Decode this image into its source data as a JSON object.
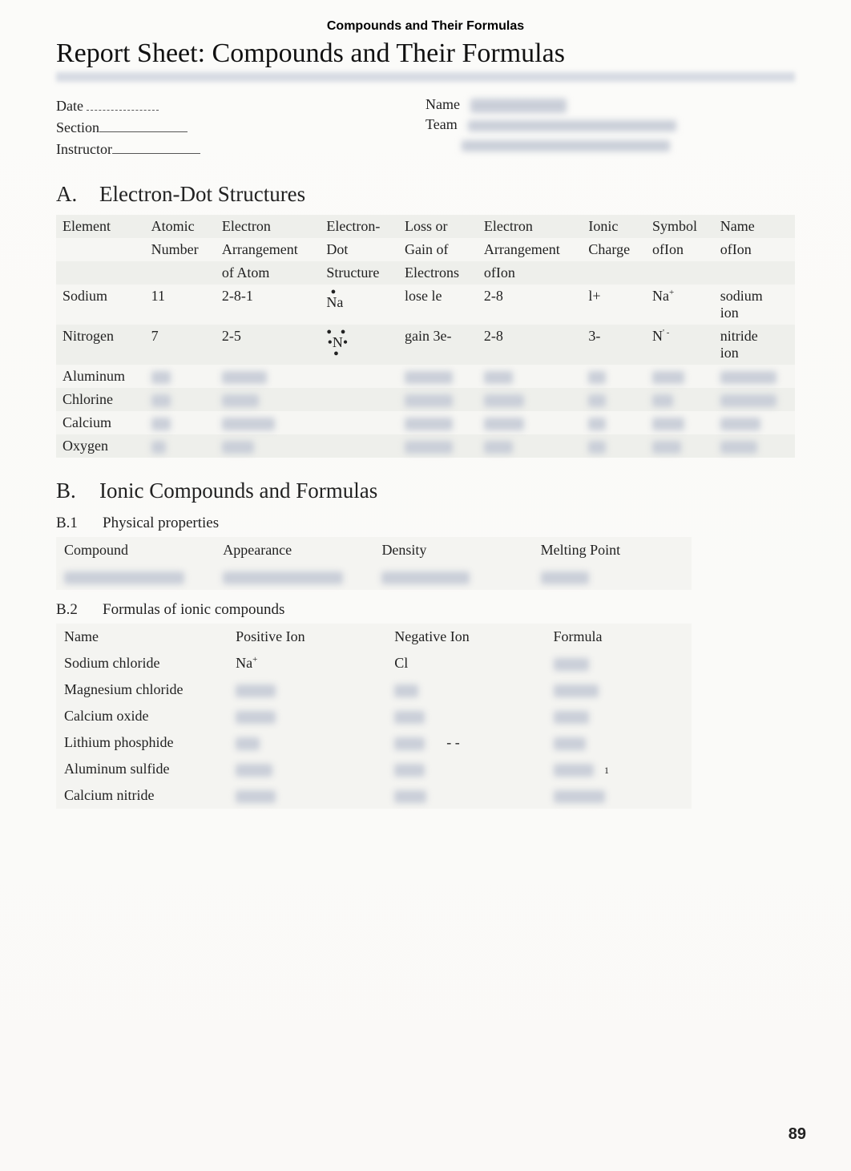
{
  "running_head": "Compounds and Their Formulas",
  "title": "Report Sheet: Compounds and Their Formulas",
  "info": {
    "date_label": "Date",
    "section_label": "Section",
    "instructor_label": "Instructor",
    "name_label": "Name",
    "team_label": "Team"
  },
  "sectionA": {
    "letter": "A.",
    "heading": "Electron-Dot Structures",
    "headers": {
      "element": "Element",
      "atomic_l1": "Atomic",
      "atomic_l2": "Number",
      "arr_l1": "Electron",
      "arr_l2": "Arrangement",
      "arr_l3": "of Atom",
      "dot_l1": "Electron-",
      "dot_l2": "Dot",
      "dot_l3": "Structure",
      "loss_l1": "Loss or",
      "loss_l2": "Gain of",
      "loss_l3": "Electrons",
      "arr2_l1": "Electron",
      "arr2_l2": "Arrangement",
      "arr2_l3": "ofIon",
      "ionic_l1": "Ionic",
      "ionic_l2": "Charge",
      "sym_l1": "Symbol",
      "sym_l2": "ofIon",
      "name_l1": "Name",
      "name_l2": "ofIon"
    },
    "rows": [
      {
        "element": "Sodium",
        "atomic": "11",
        "arrangement": "2-8-1",
        "dot_symbol": "Na",
        "dot_top": "●",
        "dot_sides": "",
        "dot_bot": "",
        "loss": "lose le",
        "arr_ion": "2-8",
        "charge": "l+",
        "symbol": "Na",
        "symbol_sup": "+",
        "ion_name_l1": "sodium",
        "ion_name_l2": "ion"
      },
      {
        "element": "Nitrogen",
        "atomic": "7",
        "arrangement": "2-5",
        "dot_symbol": "N",
        "dot_top": "● ●",
        "dot_sides": "● ●",
        "dot_bot": "●",
        "loss": "gain 3e-",
        "arr_ion": "2-8",
        "charge": "3-",
        "symbol": "N",
        "symbol_sup": "' -",
        "ion_name_l1": "nitride",
        "ion_name_l2": "ion"
      },
      {
        "element": "Aluminum"
      },
      {
        "element": "Chlorine"
      },
      {
        "element": "Calcium"
      },
      {
        "element": "Oxygen"
      }
    ]
  },
  "sectionB": {
    "letter": "B.",
    "heading": "Ionic Compounds and Formulas",
    "b1": {
      "num": "B.1",
      "title": "Physical properties",
      "headers": {
        "compound": "Compound",
        "appearance": "Appearance",
        "density": "Density",
        "mp": "Melting Point"
      }
    },
    "b2": {
      "num": "B.2",
      "title": "Formulas of ionic compounds",
      "headers": {
        "name": "Name",
        "pos": "Positive Ion",
        "neg": "Negative Ion",
        "formula": "Formula"
      },
      "rows": [
        {
          "name": "Sodium chloride",
          "pos": "Na",
          "pos_sup": "+",
          "neg": "Cl"
        },
        {
          "name": "Magnesium chloride"
        },
        {
          "name": "Calcium oxide"
        },
        {
          "name": "Lithium phosphide",
          "neg_extra": "- -"
        },
        {
          "name": "Aluminum sulfide",
          "formula_extra": "1"
        },
        {
          "name": "Calcium nitride"
        }
      ]
    }
  },
  "page_number": "89"
}
